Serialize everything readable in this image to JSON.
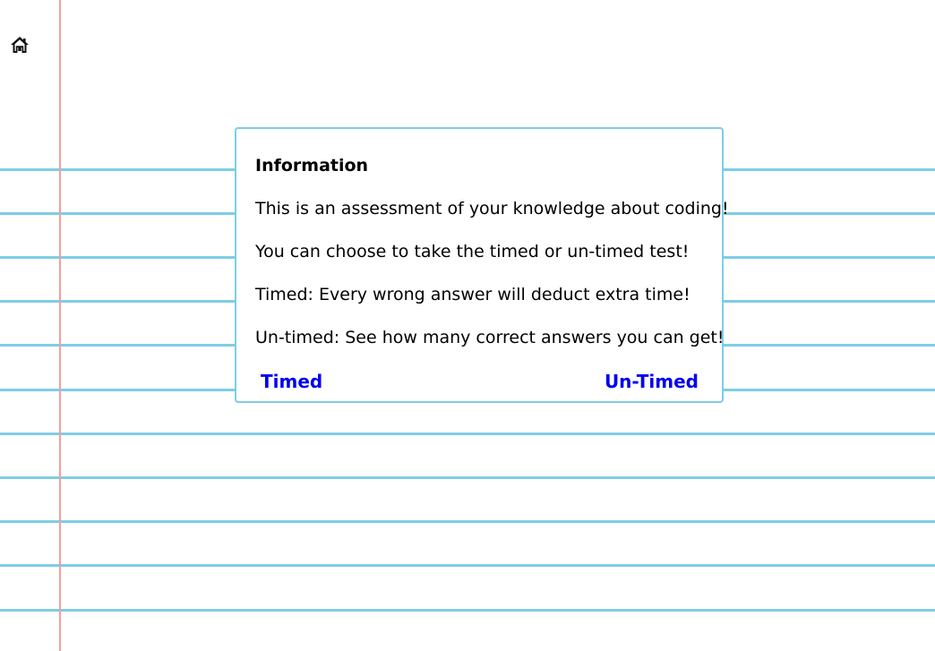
{
  "nav": {
    "home_icon": "home-icon"
  },
  "modal": {
    "title": "Information",
    "lines": [
      "This is an assessment of your knowledge about coding!",
      "You can choose to take the timed or un-timed test!",
      "Timed: Every wrong answer will deduct extra time!",
      "Un-timed: See how many correct answers you can get!"
    ],
    "timed_label": "Timed",
    "untimed_label": "Un-Timed"
  },
  "colors": {
    "rule_line": "#7ecde6",
    "margin_line": "#f0a0a0",
    "link": "#0000ee",
    "modal_border": "#7ecde6"
  }
}
